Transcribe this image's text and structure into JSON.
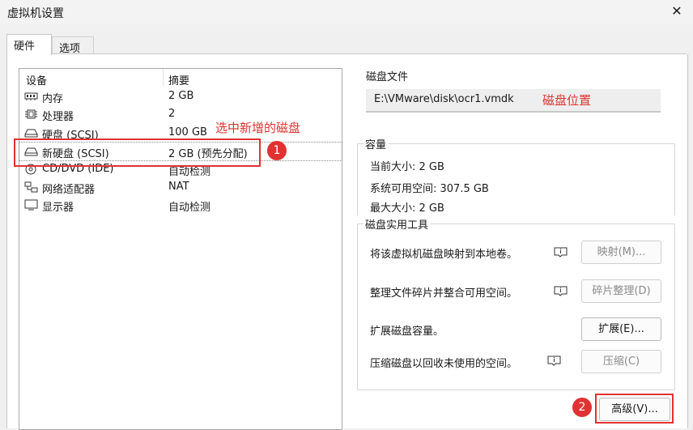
{
  "window": {
    "title": "虚拟机设置",
    "close_glyph": "✕"
  },
  "tabs": [
    {
      "label": "硬件",
      "active": true
    },
    {
      "label": "选项",
      "active": false
    }
  ],
  "device_table": {
    "header": {
      "device": "设备",
      "summary": "摘要"
    },
    "rows": [
      {
        "icon": "memory-icon",
        "name": "内存",
        "summary": "2 GB"
      },
      {
        "icon": "processor-icon",
        "name": "处理器",
        "summary": "2"
      },
      {
        "icon": "hard-disk-icon",
        "name": "硬盘 (SCSI)",
        "summary": "100 GB"
      },
      {
        "icon": "hard-disk-icon",
        "name": "新硬盘 (SCSI)",
        "summary": "2 GB (预先分配)",
        "selected": true
      },
      {
        "icon": "cd-dvd-icon",
        "name": "CD/DVD (IDE)",
        "summary": "自动检测"
      },
      {
        "icon": "network-adapter-icon",
        "name": "网络适配器",
        "summary": "NAT"
      },
      {
        "icon": "display-icon",
        "name": "显示器",
        "summary": "自动检测"
      }
    ]
  },
  "annotations": {
    "select_new_disk": "选中新增的磁盘",
    "disk_location": "磁盘位置",
    "step1": "1",
    "step2": "2",
    "color": "#e03232"
  },
  "disk_file": {
    "title": "磁盘文件",
    "path": "E:\\VMware\\disk\\ocr1.vmdk"
  },
  "capacity": {
    "title": "容量",
    "current": "当前大小: 2 GB",
    "available": "系统可用空间: 307.5 GB",
    "max": "最大大小: 2 GB"
  },
  "utilities": {
    "title": "磁盘实用工具",
    "map_text": "将该虚拟机磁盘映射到本地卷。",
    "map_button": "映射(M)...",
    "defrag_text": "整理文件碎片并整合可用空间。",
    "defrag_button": "碎片整理(D)",
    "expand_text": "扩展磁盘容量。",
    "expand_button": "扩展(E)...",
    "compact_text": "压缩磁盘以回收未使用的空间。",
    "compact_button": "压缩(C)"
  },
  "advanced_button": "高级(V)..."
}
